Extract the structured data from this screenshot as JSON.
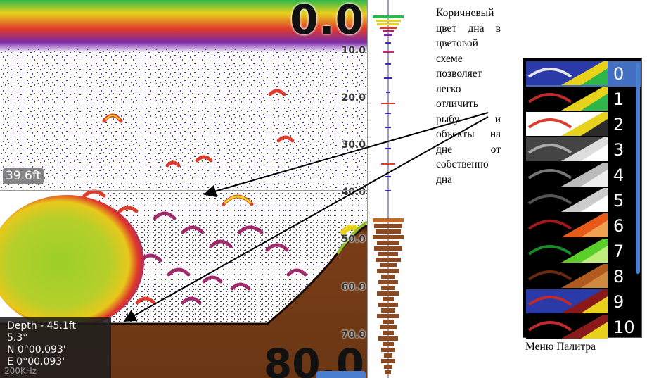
{
  "sonar": {
    "depth_readout_top": "0.0",
    "depth_readout_bottom": "80.0",
    "depth_ticks": [
      "10.0",
      "20.0",
      "30.0",
      "40.0",
      "50.0",
      "60.0",
      "70.0"
    ],
    "cursor_depth": "39.6ft",
    "info": {
      "depth": "Depth - 45.1ft",
      "temp": "5.3°",
      "lat": "N   0°00.093'",
      "lon": "E   0°00.093'",
      "freq": "200KHz"
    }
  },
  "caption": "Коричневый цвет дна в цветовой схеме позволяет легко отличить рыбу и объекты на дне от собственно дна",
  "palette_menu": {
    "title": "Меню Палитра",
    "items": [
      {
        "label": "0",
        "selected": true
      },
      {
        "label": "1",
        "selected": false
      },
      {
        "label": "2",
        "selected": false
      },
      {
        "label": "3",
        "selected": false
      },
      {
        "label": "4",
        "selected": false
      },
      {
        "label": "5",
        "selected": false
      },
      {
        "label": "6",
        "selected": false
      },
      {
        "label": "7",
        "selected": false
      },
      {
        "label": "8",
        "selected": false
      },
      {
        "label": "9",
        "selected": false
      },
      {
        "label": "10",
        "selected": false
      }
    ]
  },
  "colors": {
    "bottom_brown": "#8b4a22",
    "selection_blue": "#4470c4",
    "arch_red": "#c0282a",
    "arch_yellow": "#e8d21c",
    "noise_purple": "#4a2aa8",
    "fish_ball_green": "#8fcf2a"
  }
}
